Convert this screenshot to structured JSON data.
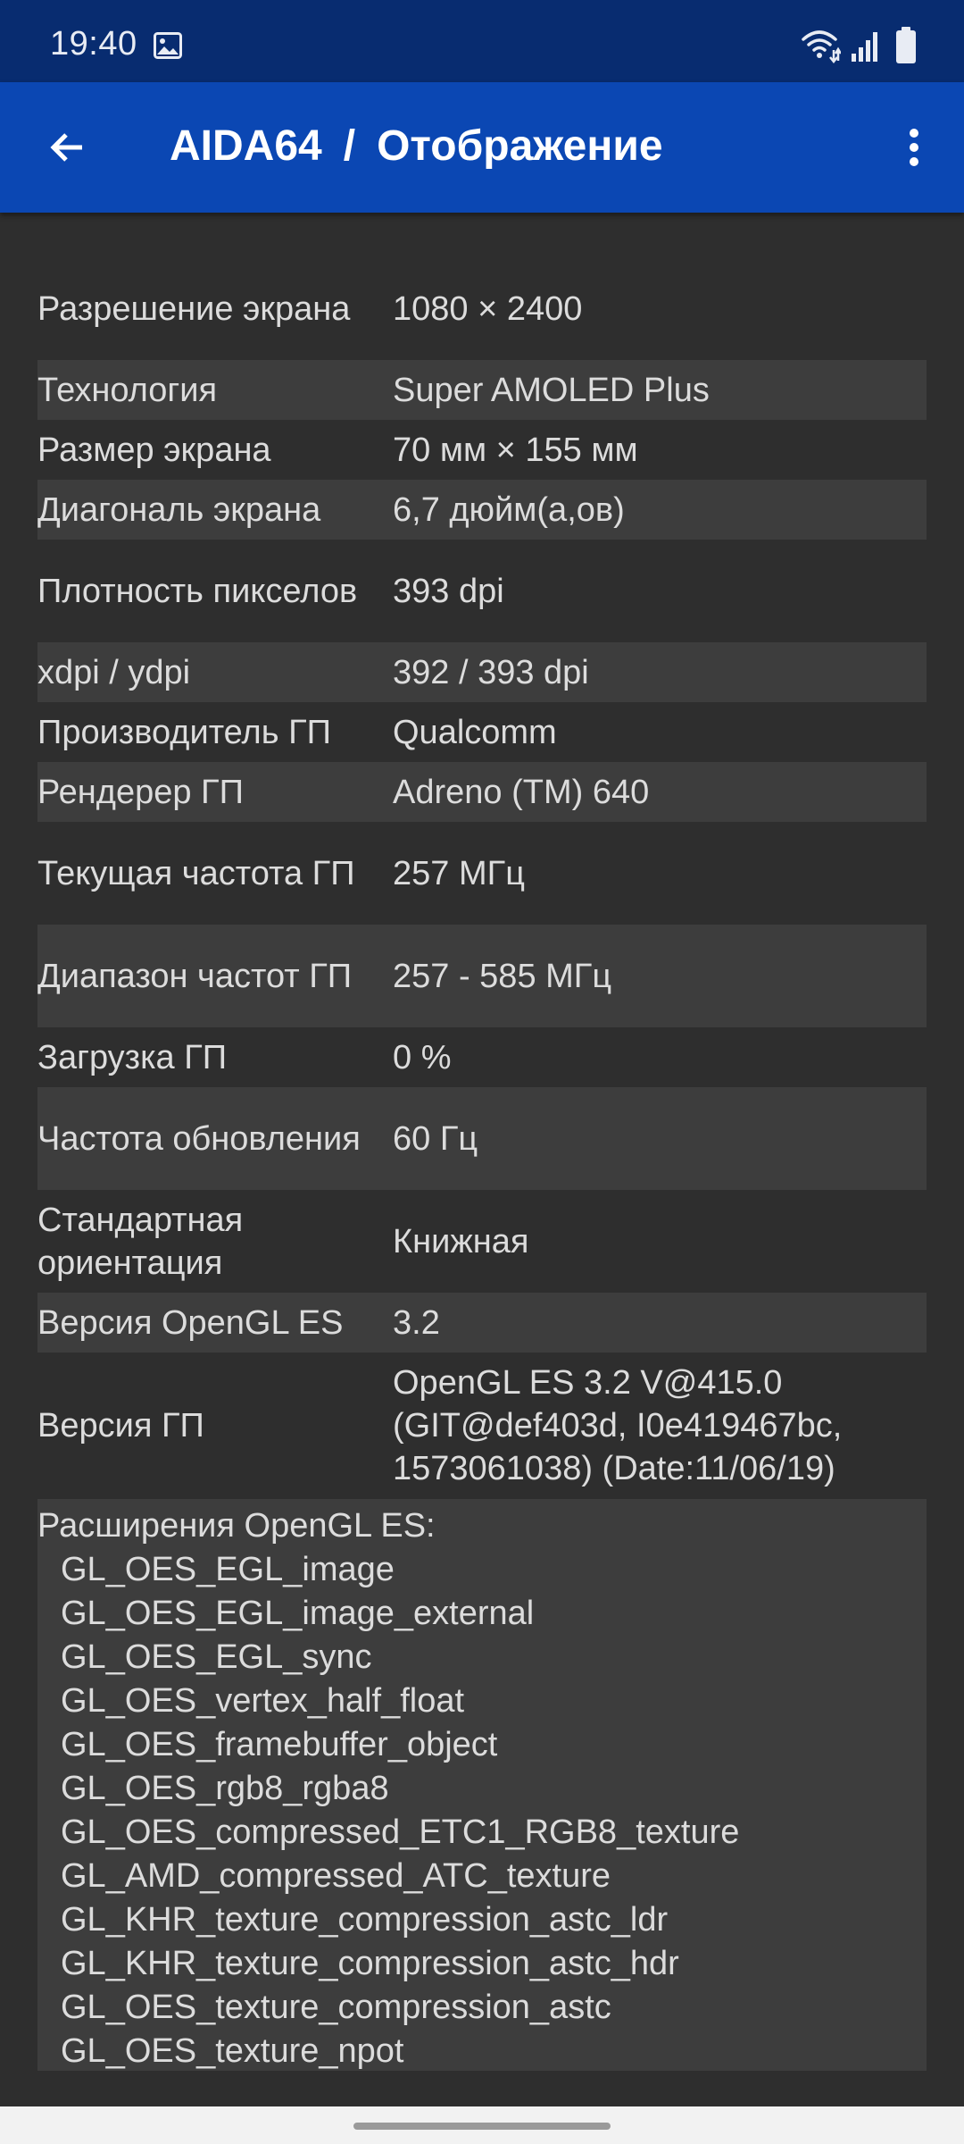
{
  "status_bar": {
    "time": "19:40"
  },
  "app_bar": {
    "app_name": "AIDA64",
    "separator": "/",
    "page_title": "Отображение"
  },
  "display_info": [
    {
      "label": "Разрешение экрана",
      "value": "1080 × 2400"
    },
    {
      "label": "Технология",
      "value": "Super AMOLED Plus"
    },
    {
      "label": "Размер экрана",
      "value": "70 мм × 155 мм"
    },
    {
      "label": "Диагональ экрана",
      "value": "6,7 дюйм(а,ов)"
    },
    {
      "label": "Плотность пикселов",
      "value": "393 dpi"
    },
    {
      "label": "xdpi / ydpi",
      "value": "392 / 393 dpi"
    },
    {
      "label": "Производитель ГП",
      "value": "Qualcomm"
    },
    {
      "label": "Рендерер ГП",
      "value": "Adreno (TM) 640"
    },
    {
      "label": "Текущая частота ГП",
      "value": "257 МГц"
    },
    {
      "label": "Диапазон частот ГП",
      "value": "257 - 585 МГц"
    },
    {
      "label": "Загрузка ГП",
      "value": "0 %"
    },
    {
      "label": "Частота обновления",
      "value": "60 Гц"
    },
    {
      "label": "Стандартная ориентация",
      "value": "Книжная"
    },
    {
      "label": "Версия OpenGL ES",
      "value": "3.2"
    },
    {
      "label": "Версия ГП",
      "value": "OpenGL ES 3.2 V@415.0 (GIT@def403d, I0e419467bc, 1573061038) (Date:11/06/19)"
    }
  ],
  "extensions": {
    "title": "Расширения OpenGL ES:",
    "items": [
      "GL_OES_EGL_image",
      "GL_OES_EGL_image_external",
      "GL_OES_EGL_sync",
      "GL_OES_vertex_half_float",
      "GL_OES_framebuffer_object",
      "GL_OES_rgb8_rgba8",
      "GL_OES_compressed_ETC1_RGB8_texture",
      "GL_AMD_compressed_ATC_texture",
      "GL_KHR_texture_compression_astc_ldr",
      "GL_KHR_texture_compression_astc_hdr",
      "GL_OES_texture_compression_astc",
      "GL_OES_texture_npot"
    ]
  },
  "icons": {
    "back": "arrow-back-icon",
    "more": "more-vert-icon",
    "gallery": "image-icon",
    "wifi": "wifi-icon",
    "signal": "signal-icon",
    "battery": "battery-icon"
  },
  "colors": {
    "status_bar": "#082c70",
    "app_bar": "#0b47b3",
    "background": "#2e2e2e",
    "row_alt": "#3d3d3d",
    "text": "#dcdcdc"
  }
}
